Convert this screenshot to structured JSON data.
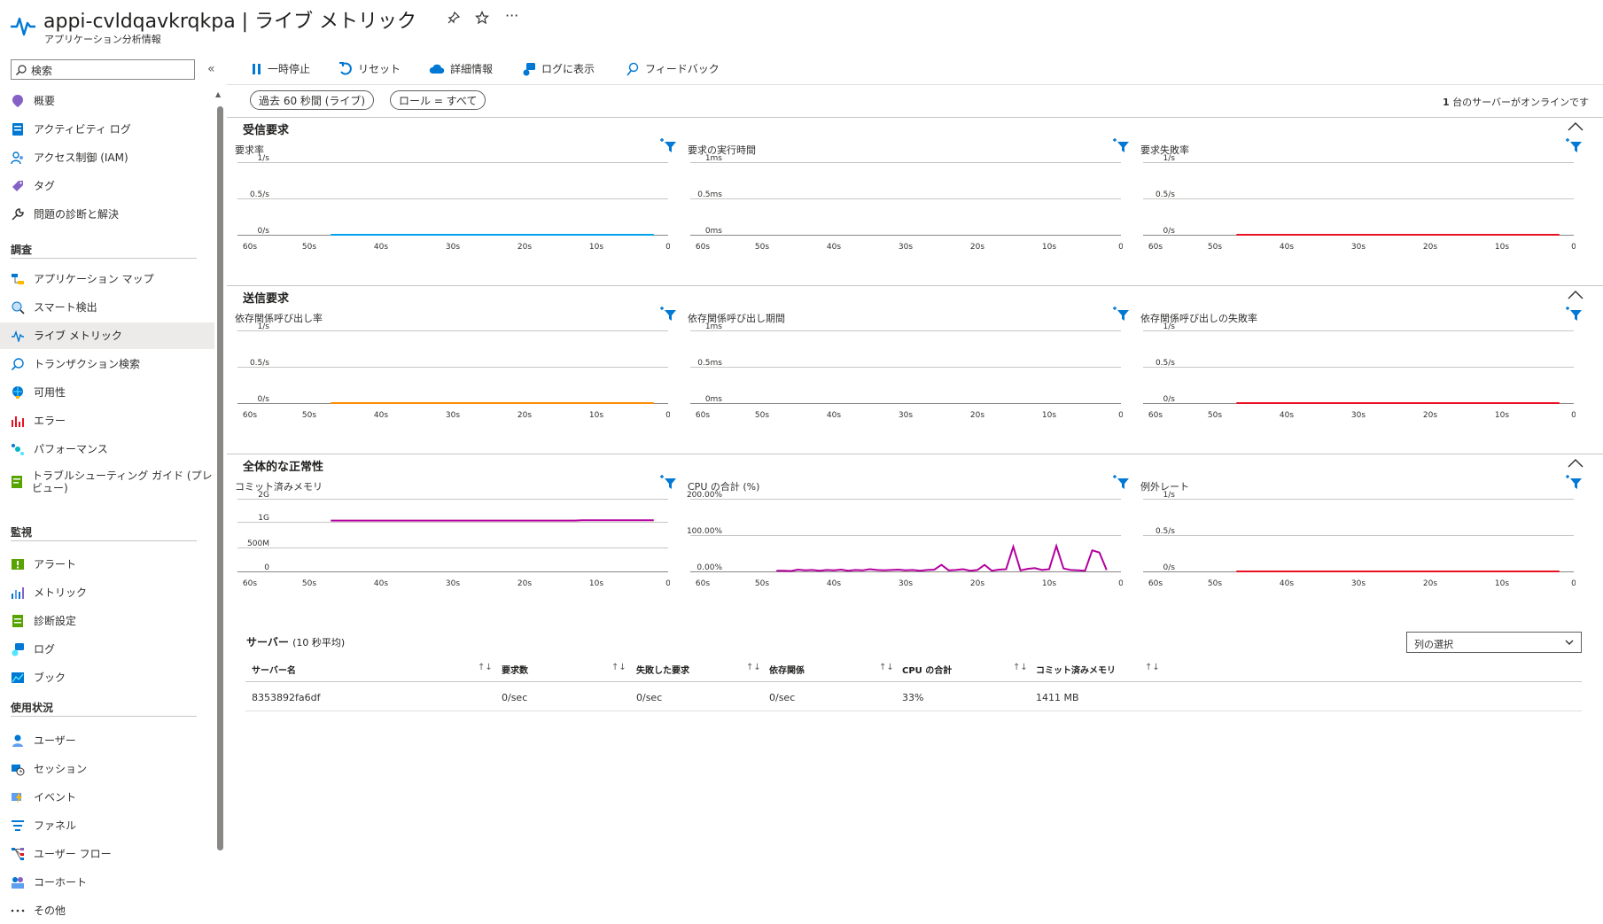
{
  "header": {
    "title": "appi-cvldqavkrqkpa | ライブ メトリック",
    "subtitle": "アプリケーション分析情報",
    "actions": [
      "pin-icon",
      "star-icon",
      "more-icon"
    ],
    "more_label": "···"
  },
  "sidebar": {
    "search_placeholder": "検索",
    "collapse_label": "«",
    "top_items": [
      {
        "label": "概要",
        "icon": "overview-icon"
      },
      {
        "label": "アクティビティ ログ",
        "icon": "activity-log-icon"
      },
      {
        "label": "アクセス制御 (IAM)",
        "icon": "iam-icon"
      },
      {
        "label": "タグ",
        "icon": "tag-icon"
      },
      {
        "label": "問題の診断と解決",
        "icon": "wrench-icon"
      }
    ],
    "sections": [
      {
        "title": "調査",
        "items": [
          {
            "label": "アプリケーション マップ",
            "icon": "app-map-icon"
          },
          {
            "label": "スマート検出",
            "icon": "smart-detect-icon"
          },
          {
            "label": "ライブ メトリック",
            "icon": "live-metrics-icon",
            "selected": true
          },
          {
            "label": "トランザクション検索",
            "icon": "search-icon"
          },
          {
            "label": "可用性",
            "icon": "availability-icon"
          },
          {
            "label": "エラー",
            "icon": "failures-icon"
          },
          {
            "label": "パフォーマンス",
            "icon": "performance-icon"
          },
          {
            "label": "トラブルシューティング ガイド (プレビュー)",
            "icon": "troubleshoot-icon"
          }
        ]
      },
      {
        "title": "監視",
        "items": [
          {
            "label": "アラート",
            "icon": "alert-icon"
          },
          {
            "label": "メトリック",
            "icon": "metrics-icon"
          },
          {
            "label": "診断設定",
            "icon": "diagnostic-icon"
          },
          {
            "label": "ログ",
            "icon": "logs-icon"
          },
          {
            "label": "ブック",
            "icon": "workbook-icon"
          }
        ]
      },
      {
        "title": "使用状況",
        "items": [
          {
            "label": "ユーザー",
            "icon": "users-icon"
          },
          {
            "label": "セッション",
            "icon": "sessions-icon"
          },
          {
            "label": "イベント",
            "icon": "events-icon"
          },
          {
            "label": "ファネル",
            "icon": "funnel-icon"
          },
          {
            "label": "ユーザー フロー",
            "icon": "user-flow-icon"
          },
          {
            "label": "コーホート",
            "icon": "cohort-icon"
          },
          {
            "label": "その他",
            "icon": "more-icon"
          }
        ]
      }
    ]
  },
  "toolbar": {
    "pause": "一時停止",
    "reset": "リセット",
    "details": "詳細情報",
    "show_in_logs": "ログに表示",
    "feedback": "フィードバック"
  },
  "filters": {
    "time": "過去 60 秒間 (ライブ)",
    "role": "ロール = すべて"
  },
  "status": {
    "count": "1",
    "text": "台のサーバーがオンラインです"
  },
  "sections": [
    {
      "title": "受信要求"
    },
    {
      "title": "送信要求"
    },
    {
      "title": "全体的な正常性"
    }
  ],
  "chart_data": [
    {
      "type": "line",
      "title": "要求率",
      "y_ticks": [
        "1/s",
        "0.5/s",
        "0/s"
      ],
      "x_ticks": [
        "60s",
        "50s",
        "40s",
        "30s",
        "20s",
        "10s",
        "0"
      ],
      "ylim": [
        0,
        1
      ],
      "color": "#00a2ed",
      "series": [
        {
          "x": [
            47,
            2
          ],
          "y": [
            0,
            0
          ]
        }
      ]
    },
    {
      "type": "line",
      "title": "要求の実行時間",
      "y_ticks": [
        "1ms",
        "0.5ms",
        "0ms"
      ],
      "x_ticks": [
        "60s",
        "50s",
        "40s",
        "30s",
        "20s",
        "10s",
        "0"
      ],
      "ylim": [
        0,
        1
      ],
      "color": "#00a2ed",
      "series": []
    },
    {
      "type": "line",
      "title": "要求失敗率",
      "y_ticks": [
        "1/s",
        "0.5/s",
        "0/s"
      ],
      "x_ticks": [
        "60s",
        "50s",
        "40s",
        "30s",
        "20s",
        "10s",
        "0"
      ],
      "ylim": [
        0,
        1
      ],
      "color": "#e81123",
      "series": [
        {
          "x": [
            47,
            2
          ],
          "y": [
            0,
            0
          ]
        }
      ]
    },
    {
      "type": "line",
      "title": "依存関係呼び出し率",
      "y_ticks": [
        "1/s",
        "0.5/s",
        "0/s"
      ],
      "x_ticks": [
        "60s",
        "50s",
        "40s",
        "30s",
        "20s",
        "10s",
        "0"
      ],
      "ylim": [
        0,
        1
      ],
      "color": "#ff8c00",
      "series": [
        {
          "x": [
            47,
            2
          ],
          "y": [
            0,
            0
          ]
        }
      ]
    },
    {
      "type": "line",
      "title": "依存関係呼び出し期間",
      "y_ticks": [
        "1ms",
        "0.5ms",
        "0ms"
      ],
      "x_ticks": [
        "60s",
        "50s",
        "40s",
        "30s",
        "20s",
        "10s",
        "0"
      ],
      "ylim": [
        0,
        1
      ],
      "color": "#ff8c00",
      "series": []
    },
    {
      "type": "line",
      "title": "依存関係呼び出しの失敗率",
      "y_ticks": [
        "1/s",
        "0.5/s",
        "0/s"
      ],
      "x_ticks": [
        "60s",
        "50s",
        "40s",
        "30s",
        "20s",
        "10s",
        "0"
      ],
      "ylim": [
        0,
        1
      ],
      "color": "#e81123",
      "series": [
        {
          "x": [
            47,
            2
          ],
          "y": [
            0,
            0
          ]
        }
      ]
    },
    {
      "type": "line",
      "title": "コミット済みメモリ",
      "y_ticks": [
        "2G",
        "1G",
        "500M",
        "0"
      ],
      "x_ticks": [
        "60s",
        "50s",
        "40s",
        "30s",
        "20s",
        "10s",
        "0"
      ],
      "ylim": [
        0,
        2
      ],
      "color": "#b4009e",
      "series": [
        {
          "x": [
            47,
            40,
            30,
            20,
            13,
            12,
            2
          ],
          "y": [
            1.4,
            1.4,
            1.4,
            1.4,
            1.4,
            1.41,
            1.41
          ]
        }
      ]
    },
    {
      "type": "line",
      "title": "CPU の合計 (%)",
      "y_ticks": [
        "200.00%",
        "100.00%",
        "0.00%"
      ],
      "x_ticks": [
        "60s",
        "50s",
        "40s",
        "30s",
        "20s",
        "10s",
        "0"
      ],
      "ylim": [
        0,
        200
      ],
      "color": "#b4009e",
      "series": [
        {
          "x": [
            48,
            47,
            46,
            45,
            44,
            43,
            42,
            41,
            40,
            39,
            38,
            37,
            36,
            35,
            34,
            33,
            32,
            31,
            30,
            29,
            28,
            27,
            26,
            25,
            24,
            23,
            22,
            21,
            20,
            19,
            18,
            17,
            16,
            15,
            14,
            13,
            12,
            11,
            10,
            9,
            8,
            7,
            6,
            5,
            4,
            3,
            2
          ],
          "y": [
            2,
            2,
            1,
            5,
            3,
            4,
            2,
            4,
            3,
            5,
            2,
            4,
            3,
            6,
            4,
            3,
            4,
            5,
            3,
            4,
            2,
            4,
            5,
            18,
            3,
            4,
            6,
            2,
            4,
            18,
            2,
            5,
            6,
            68,
            3,
            7,
            9,
            4,
            6,
            70,
            8,
            4,
            3,
            2,
            58,
            52,
            4
          ]
        }
      ]
    },
    {
      "type": "line",
      "title": "例外レート",
      "y_ticks": [
        "1/s",
        "0.5/s",
        "0/s"
      ],
      "x_ticks": [
        "60s",
        "50s",
        "40s",
        "30s",
        "20s",
        "10s",
        "0"
      ],
      "ylim": [
        0,
        1
      ],
      "color": "#e81123",
      "series": [
        {
          "x": [
            47,
            2
          ],
          "y": [
            0,
            0
          ]
        }
      ]
    }
  ],
  "servers": {
    "title": "サーバー",
    "subtitle": "(10 秒平均)",
    "column_select": "列の選択",
    "columns": [
      "サーバー名",
      "要求数",
      "失敗した要求",
      "依存関係",
      "CPU の合計",
      "コミット済みメモリ"
    ],
    "sort_glyph": "↑↓",
    "rows": [
      [
        "8353892fa6df",
        "0/sec",
        "0/sec",
        "0/sec",
        "33%",
        "1411 MB"
      ]
    ]
  },
  "colors": {
    "accent": "#0078d4",
    "selected_bg": "#edebe9"
  }
}
